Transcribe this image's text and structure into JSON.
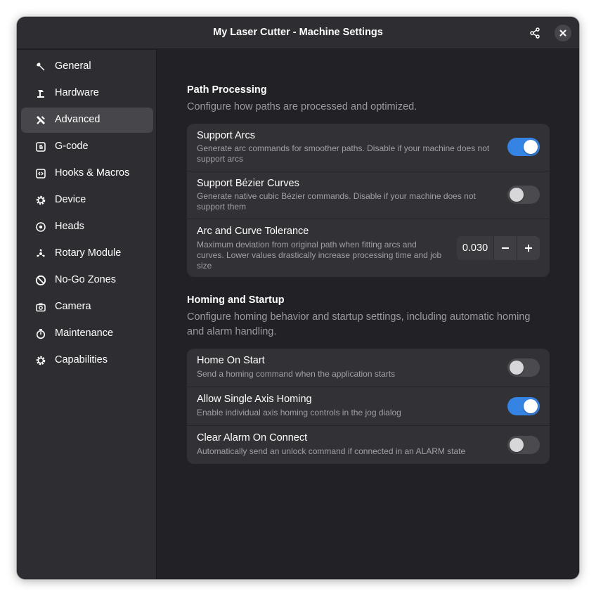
{
  "window": {
    "title": "My Laser Cutter - Machine Settings"
  },
  "headerbar": {
    "share_icon": "share-icon",
    "close_icon": "close-icon"
  },
  "sidebar": {
    "items": [
      {
        "label": "General",
        "icon": "wrench-icon",
        "active": false
      },
      {
        "label": "Hardware",
        "icon": "laser-arm-icon",
        "active": false
      },
      {
        "label": "Advanced",
        "icon": "tools-icon",
        "active": true
      },
      {
        "label": "G-code",
        "icon": "gcode-icon",
        "active": false
      },
      {
        "label": "Hooks & Macros",
        "icon": "code-icon",
        "active": false
      },
      {
        "label": "Device",
        "icon": "gear-icon",
        "active": false
      },
      {
        "label": "Heads",
        "icon": "target-icon",
        "active": false
      },
      {
        "label": "Rotary Module",
        "icon": "rotary-icon",
        "active": false
      },
      {
        "label": "No-Go Zones",
        "icon": "prohibited-icon",
        "active": false
      },
      {
        "label": "Camera",
        "icon": "camera-icon",
        "active": false
      },
      {
        "label": "Maintenance",
        "icon": "stopwatch-icon",
        "active": false
      },
      {
        "label": "Capabilities",
        "icon": "cog-icon",
        "active": false
      }
    ]
  },
  "path_processing": {
    "title": "Path Processing",
    "description": "Configure how paths are processed and optimized.",
    "rows": [
      {
        "title": "Support Arcs",
        "subtitle_line1": "Generate arc commands for smoother paths. Disable if your machine does not",
        "subtitle_line2": "support arcs",
        "enabled": true
      },
      {
        "title": "Support Bézier Curves",
        "subtitle_line1": "Generate native cubic Bézier commands. Disable if your machine does not",
        "subtitle_line2": "support them",
        "enabled": false
      }
    ],
    "tolerance": {
      "title": "Arc and Curve Tolerance",
      "subtitle_line1": "Maximum deviation from original path when fitting arcs and",
      "subtitle_line2": "curves. Lower values drastically increase processing time and job",
      "subtitle_line3": "size",
      "value": "0.030",
      "decrement": "−",
      "increment": "+"
    }
  },
  "homing": {
    "title": "Homing and Startup",
    "description_line1": "Configure homing behavior and startup settings, including automatic homing",
    "description_line2": "and alarm handling.",
    "rows": [
      {
        "title": "Home On Start",
        "subtitle": "Send a homing command when the application starts",
        "enabled": false
      },
      {
        "title": "Allow Single Axis Homing",
        "subtitle": "Enable individual axis homing controls in the jog dialog",
        "enabled": true
      },
      {
        "title": "Clear Alarm On Connect",
        "subtitle": "Automatically send an unlock command if connected in an ALARM state",
        "enabled": false
      }
    ]
  },
  "colors": {
    "accent": "#3584e4",
    "window_bg": "#222226",
    "sidebar_bg": "#2e2e32",
    "card_bg": "#323236"
  }
}
